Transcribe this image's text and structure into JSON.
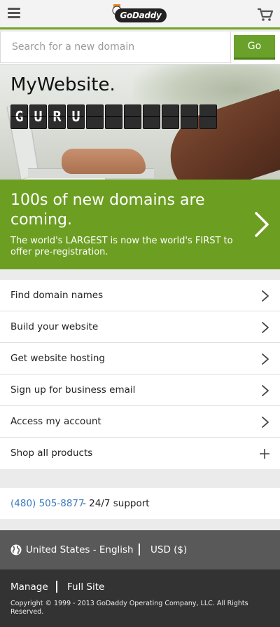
{
  "header": {
    "logo_text": "GoDaddy",
    "icons": {
      "menu": "hamburger-icon",
      "cart": "cart-icon"
    }
  },
  "search": {
    "placeholder": "Search for a new domain",
    "value": "",
    "button_label": "Go"
  },
  "hero": {
    "title": "MyWebsite.",
    "tiles": [
      "G",
      "U",
      "R",
      "U",
      "",
      "",
      "",
      "",
      "",
      "",
      "",
      ""
    ]
  },
  "promo": {
    "title": "100s of new domains are coming.",
    "subtitle": "The world's LARGEST is now the world's FIRST to offer pre-registration."
  },
  "nav": {
    "items": [
      {
        "label": "Find domain names",
        "icon": "chevron-right-icon"
      },
      {
        "label": "Build your website",
        "icon": "chevron-right-icon"
      },
      {
        "label": "Get website hosting",
        "icon": "chevron-right-icon"
      },
      {
        "label": "Sign up for business email",
        "icon": "chevron-right-icon"
      },
      {
        "label": "Access my account",
        "icon": "chevron-right-icon"
      },
      {
        "label": "Shop all products",
        "icon": "plus-icon"
      }
    ]
  },
  "support": {
    "phone": "(480) 505-8877",
    "text": "- 24/7 support"
  },
  "locale": {
    "language": "United States - English",
    "currency": "USD ($)"
  },
  "footer": {
    "manage": "Manage",
    "full_site": "Full Site",
    "copyright": "Copyright © 1999 - 2013 GoDaddy Operating Company, LLC. All Rights Reserved."
  },
  "colors": {
    "brand_green": "#6c9e22",
    "button_green": "#6aa12a",
    "link_blue": "#3b7bbf",
    "locale_bg": "#595959",
    "footer_bg": "#333333"
  }
}
